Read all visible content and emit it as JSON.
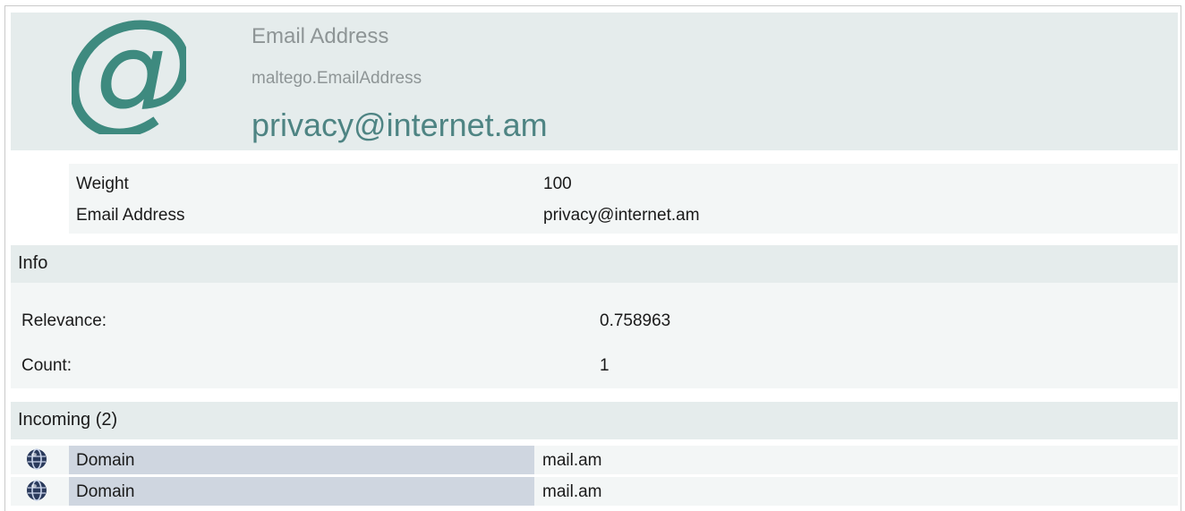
{
  "header": {
    "icon": "at-sign-icon",
    "entity_type": "Email Address",
    "entity_class": "maltego.EmailAddress",
    "entity_value": "privacy@internet.am"
  },
  "properties": [
    {
      "key": "Weight",
      "value": "100"
    },
    {
      "key": "Email Address",
      "value": "privacy@internet.am"
    }
  ],
  "info": {
    "title": "Info",
    "rows": [
      {
        "label": "Relevance:",
        "value": "0.758963"
      },
      {
        "label": "Count:",
        "value": "1"
      }
    ]
  },
  "incoming": {
    "title": "Incoming (2)",
    "items": [
      {
        "icon": "domain-globe-icon",
        "type": "Domain",
        "value": "mail.am"
      },
      {
        "icon": "domain-globe-icon",
        "type": "Domain",
        "value": "mail.am"
      }
    ]
  },
  "colors": {
    "header_bg": "#e5ecec",
    "accent": "#4e8483",
    "icon_teal": "#3e8a7f",
    "link_bg": "#cfd6e0"
  }
}
